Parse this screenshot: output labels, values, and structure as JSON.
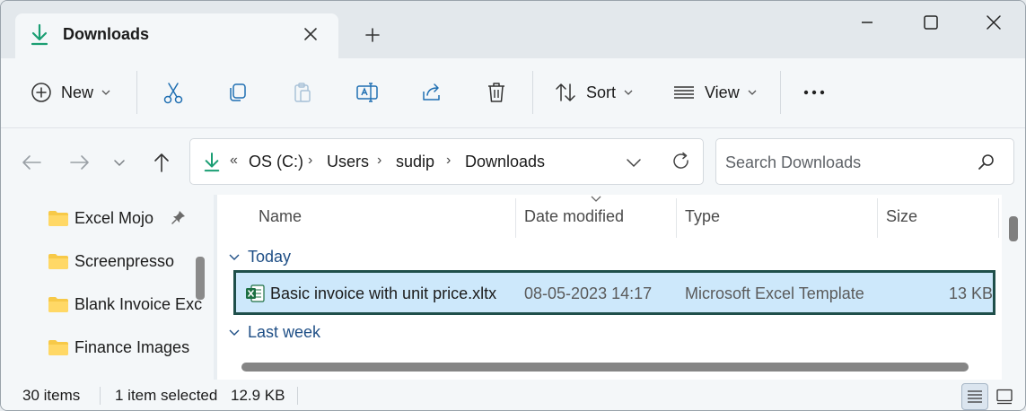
{
  "window": {
    "tab_title": "Downloads",
    "icons": {
      "tab": "download-icon",
      "close_tab": "close-icon",
      "new_tab": "plus-icon",
      "minimize": "minimize-icon",
      "maximize": "maximize-icon",
      "close": "close-icon"
    }
  },
  "toolbar": {
    "new_label": "New",
    "sort_label": "Sort",
    "view_label": "View",
    "icons": [
      "add-circle-icon",
      "cut-icon",
      "copy-icon",
      "paste-icon",
      "rename-icon",
      "share-icon",
      "delete-icon",
      "sort-icon",
      "view-icon",
      "more-icon"
    ]
  },
  "address": {
    "overflow": "«",
    "crumbs": [
      "OS (C:)",
      "Users",
      "sudip",
      "Downloads"
    ],
    "search_placeholder": "Search Downloads"
  },
  "nav_pane": {
    "items": [
      {
        "label": "Excel Mojo",
        "pinned": true
      },
      {
        "label": "Screenpresso"
      },
      {
        "label": "Blank Invoice Exc"
      },
      {
        "label": "Finance Images"
      }
    ]
  },
  "content": {
    "columns": [
      "Name",
      "Date modified",
      "Type",
      "Size"
    ],
    "groups": [
      {
        "label": "Today",
        "files": [
          {
            "name": "Basic invoice with unit price.xltx",
            "date_modified": "08-05-2023 14:17",
            "type": "Microsoft Excel Template",
            "size": "13 KB",
            "selected": true
          }
        ]
      },
      {
        "label": "Last week",
        "files": []
      }
    ]
  },
  "status": {
    "item_count": "30 items",
    "selection": "1 item selected",
    "selection_size": "12.9 KB"
  },
  "colors": {
    "accent": "#1a9e73",
    "selection_bg": "#cde8fb",
    "selection_border": "#1f4f4a",
    "excel_green": "#1d6f42",
    "group_text": "#1f4f86"
  }
}
